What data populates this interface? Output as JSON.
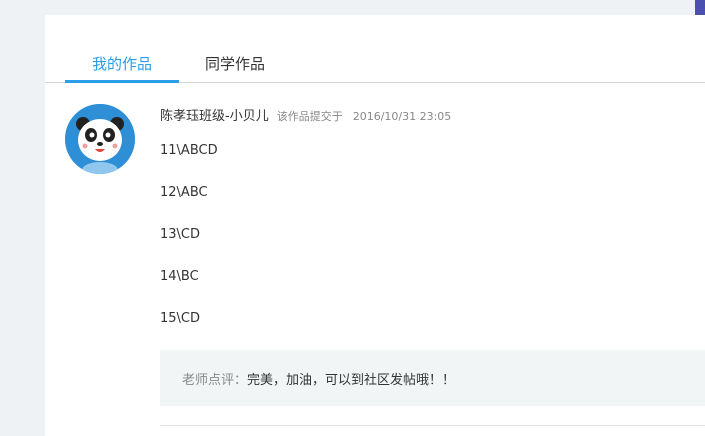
{
  "tabs": [
    {
      "label": "我的作品",
      "active": true
    },
    {
      "label": "同学作品",
      "active": false
    }
  ],
  "submission": {
    "author": "陈孝珏班级-小贝儿",
    "submitted_label": "该作品提交于",
    "submitted_time": "2016/10/31 23:05",
    "avatar_icon": "panda-avatar-icon",
    "answers": [
      "11\\ABCD",
      "12\\ABC",
      "13\\CD",
      "14\\BC",
      "15\\CD"
    ],
    "comment_label": "老师点评：",
    "comment_text": "完美，加油，可以到社区发帖哦！！"
  },
  "colors": {
    "accent": "#2a9ee8",
    "side_panel": "#4b4fb0",
    "avatar_bg": "#2e8fd6"
  }
}
